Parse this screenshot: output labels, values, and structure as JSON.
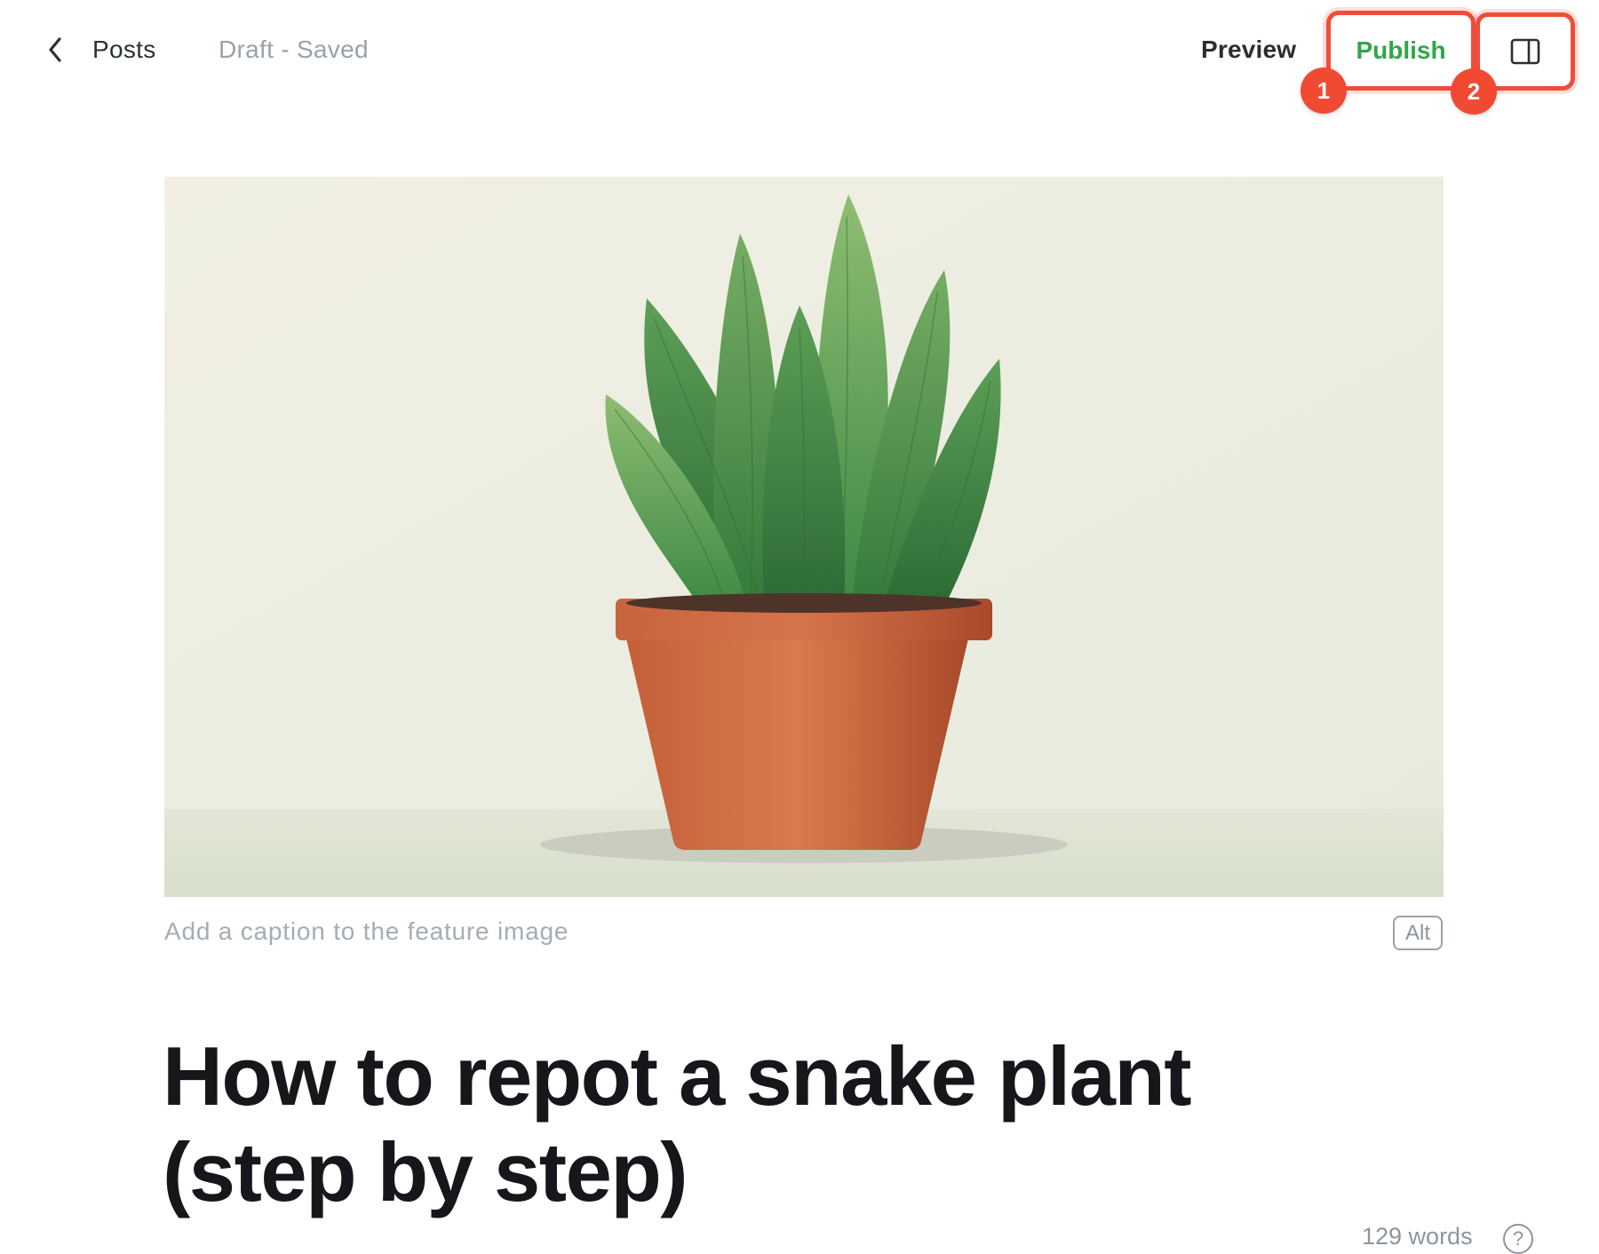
{
  "header": {
    "back_label": "Posts",
    "status": "Draft - Saved",
    "preview_label": "Preview",
    "publish_label": "Publish",
    "settings_icon": "sidebar-toggle-icon",
    "annotations": [
      "1",
      "2"
    ]
  },
  "feature_image": {
    "caption_placeholder": "Add a caption to the feature image",
    "alt_label": "Alt",
    "subject": "potted snake plant illustration"
  },
  "post": {
    "title_line1": "How to repot a snake plant",
    "title_line2": "(step by step)"
  },
  "footer": {
    "word_count": "129 words",
    "help_icon": "?"
  },
  "colors": {
    "publish_text": "#30a64a",
    "highlight_border": "#ef4d3a",
    "badge": "#f04a33",
    "muted_text": "#9aa1aa"
  }
}
